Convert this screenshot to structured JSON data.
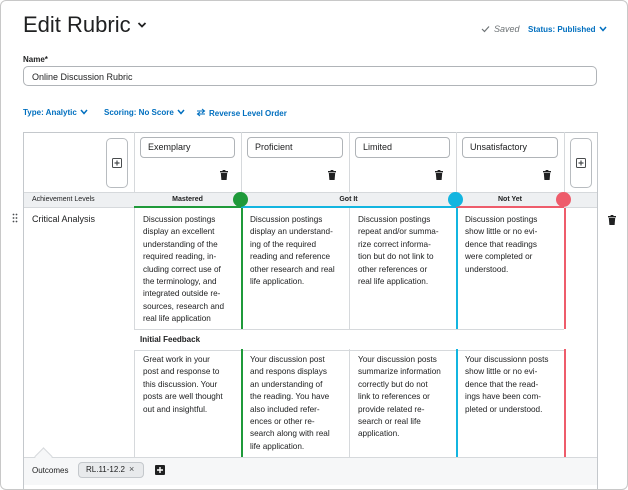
{
  "header": {
    "title": "Edit Rubric",
    "saved_label": "Saved",
    "status_label": "Status: Published"
  },
  "name_field": {
    "label": "Name*",
    "value": "Online Discussion Rubric"
  },
  "options": {
    "type_label": "Type: Analytic",
    "scoring_label": "Scoring: No Score",
    "reverse_label": "Reverse Level Order"
  },
  "levels": [
    {
      "name": "Exemplary"
    },
    {
      "name": "Proficient"
    },
    {
      "name": "Limited"
    },
    {
      "name": "Unsatisfactory"
    }
  ],
  "achievement": {
    "label": "Achievement Levels",
    "names": [
      "Mastered",
      "Got It",
      "Not Yet"
    ],
    "colors": [
      "#1f9a3a",
      "#13b5e0",
      "#ee5c6b"
    ]
  },
  "criterion": {
    "name": "Critical Analysis",
    "descriptions": [
      [
        "Discussion postings",
        "display an excellent",
        "understanding of the",
        "required reading, in-",
        "cluding correct use of",
        "the terminology, and",
        "integrated outside re-",
        "sources, research and",
        "real life application"
      ],
      [
        "Discussion postings",
        "display an understand-",
        "ing of the required",
        "reading and reference",
        "other research and real",
        "life application."
      ],
      [
        "Discussion postings",
        "repeat and/or summa-",
        "rize correct informa-",
        "tion but do not link to",
        "other references or",
        "real life application."
      ],
      [
        "Discussion postings",
        "show little or no evi-",
        "dence that readings",
        "were completed or",
        "understood."
      ]
    ],
    "feedback_label": "Initial Feedback",
    "feedback": [
      [
        "Great work in your",
        "post and response to",
        "this discussion.  Your",
        "posts are well thought",
        "out and insightful."
      ],
      [
        "Your discussion post",
        "and respons displays",
        "an understanding of",
        "the reading.  You have",
        "also included refer-",
        "ences or other re-",
        "search along with real",
        "life application."
      ],
      [
        "Your discussion posts",
        "summarize information",
        "correctly but do not",
        "link to references or",
        "provide related re-",
        "search or real life",
        "application."
      ],
      [
        "Your discussionn posts",
        "show little or no evi-",
        "dence that the read-",
        "ings have been com-",
        "pleted or understood."
      ]
    ]
  },
  "outcomes": {
    "label": "Outcomes",
    "chip": "RL.11-12.2",
    "chip_remove": "×"
  },
  "icons": {
    "title_chevron": "chevron-down-icon",
    "saved_check": "check-icon",
    "add": "plus-icon",
    "delete": "trash-icon",
    "drag": "drag-handle-icon",
    "reverse": "swap-arrows-icon"
  }
}
